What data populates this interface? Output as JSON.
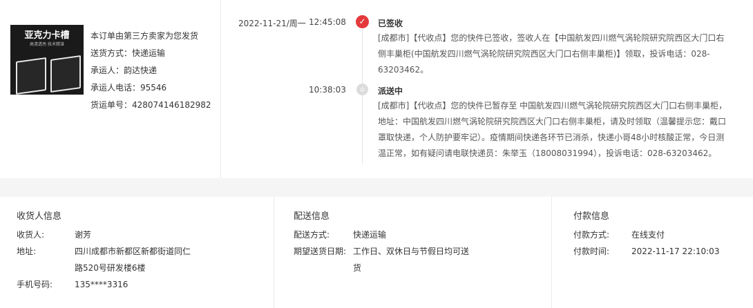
{
  "product": {
    "image_title": "亚克力卡槽",
    "image_subtitle": "高清透亮·技术精湛",
    "lines": [
      "本订单由第三方卖家为您发货",
      "送货方式：快递运输",
      "承运人：韵达快递",
      "承运人电话：95546",
      "货运单号：428074146182982"
    ]
  },
  "timeline": {
    "date": "2022-11-21/周一",
    "events": [
      {
        "time": "12:45:08",
        "status": "已签收",
        "desc": "[成都市]【代收点】您的快件已签收，签收人在【中国航发四川燃气涡轮院研究院西区大门口右侧丰巢柜(中国航发四川燃气涡轮院研究院西区大门口右侧丰巢柜)】领取，投诉电话：028-63203462。"
      },
      {
        "time": "10:38:03",
        "status": "派送中",
        "desc": "[成都市]【代收点】您的快件已暂存至 中国航发四川燃气涡轮院研究院西区大门口右侧丰巢柜，地址：中国航发四川燃气涡轮院研究院西区大门口右侧丰巢柜，请及时领取（温馨提示您：戴口罩取快递，个人防护要牢记）。疫情期间快递各环节已消杀，快递小哥48小时核酸正常，今日测温正常，如有疑问请电联快递员：朱举玉（18008031994），投诉电话：028-63203462。"
      }
    ]
  },
  "receiver": {
    "title": "收货人信息",
    "name_label": "收货人:",
    "name": "谢芳",
    "address_label": "地址:",
    "address": "四川成都市新都区新都街道同仁路520号研发楼6楼",
    "phone_label": "手机号码:",
    "phone": "135****3316"
  },
  "delivery": {
    "title": "配送信息",
    "method_label": "配送方式:",
    "method": "快递运输",
    "date_label": "期望送货日期:",
    "date": "工作日、双休日与节假日均可送货"
  },
  "payment": {
    "title": "付款信息",
    "method_label": "付款方式:",
    "method": "在线支付",
    "time_label": "付款时间:",
    "time": "2022-11-17 22:10:03"
  },
  "colors": {
    "accent": "#e4393c",
    "pending": "#dcdcdc",
    "band": "#f5f5f5"
  },
  "icons": {
    "signed": "check-circle-icon",
    "delivering": "house-icon"
  }
}
